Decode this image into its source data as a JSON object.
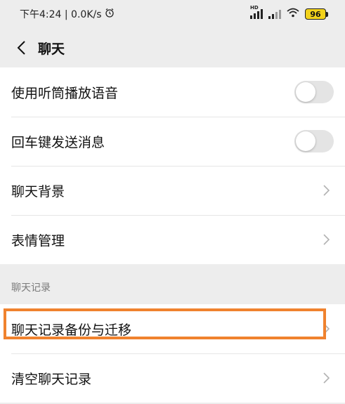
{
  "status_bar": {
    "time_speed": "下午4:24 | 0.0K/s",
    "alarm_icon": "alarm-clock-icon",
    "hd_label": "HD",
    "battery_level": "96"
  },
  "nav": {
    "back_icon": "chevron-left-icon",
    "title": "聊天"
  },
  "settings": [
    {
      "label": "使用听筒播放语音",
      "control": "toggle",
      "on": false
    },
    {
      "label": "回车键发送消息",
      "control": "toggle",
      "on": false
    },
    {
      "label": "聊天背景",
      "control": "chevron"
    },
    {
      "label": "表情管理",
      "control": "chevron"
    }
  ],
  "chat_history": {
    "section_title": "聊天记录",
    "items": [
      {
        "label": "聊天记录备份与迁移",
        "control": "chevron",
        "highlighted": true
      },
      {
        "label": "清空聊天记录",
        "control": "chevron"
      }
    ]
  },
  "colors": {
    "highlight": "#f0822e",
    "battery": "#f2d21b",
    "background": "#ededed"
  }
}
